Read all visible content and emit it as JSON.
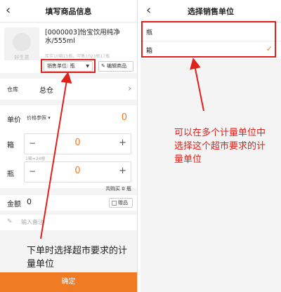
{
  "left": {
    "title": "填写商品信息",
    "back_icon": "‹",
    "product": {
      "logo_text": "好生意",
      "name": "[0000003]怡宝饮用纯净水/555ml",
      "stock": "库存10箱15瓶，可售1023瓶17瓶"
    },
    "unit_selector": {
      "label": "销售单位: 瓶",
      "caret": "▼"
    },
    "edit_product": {
      "icon": "✎",
      "label": "编辑商品"
    },
    "warehouse": {
      "label": "仓库",
      "value": "总仓",
      "chevron": "›"
    },
    "price": {
      "label": "单价",
      "selector": "价格参照 ▾",
      "value": "0"
    },
    "box": {
      "label": "箱",
      "minus": "−",
      "value": "0",
      "plus": "+",
      "hint": "1箱=24瓶"
    },
    "bottle": {
      "label": "瓶",
      "minus": "−",
      "value": "0",
      "plus": "+"
    },
    "total": {
      "prefix": "共购买",
      "count": "0",
      "unit": "瓶"
    },
    "amount": {
      "label": "金额",
      "value": "0",
      "gift_label": "赠品"
    },
    "note": {
      "icon": "✎",
      "placeholder": "输入备注"
    },
    "confirm_label": "确定",
    "annotation": "下单时选择超市要求的计量单位"
  },
  "right": {
    "title": "选择销售单位",
    "back_icon": "‹",
    "units": [
      {
        "label": "瓶",
        "selected": false
      },
      {
        "label": "箱",
        "selected": true
      }
    ],
    "check_icon": "✓",
    "annotation": "可以在多个计量单位中选择这个超市要求的计量单位"
  },
  "colors": {
    "accent": "#ef7c24",
    "annotation_red": "#e0201a"
  }
}
